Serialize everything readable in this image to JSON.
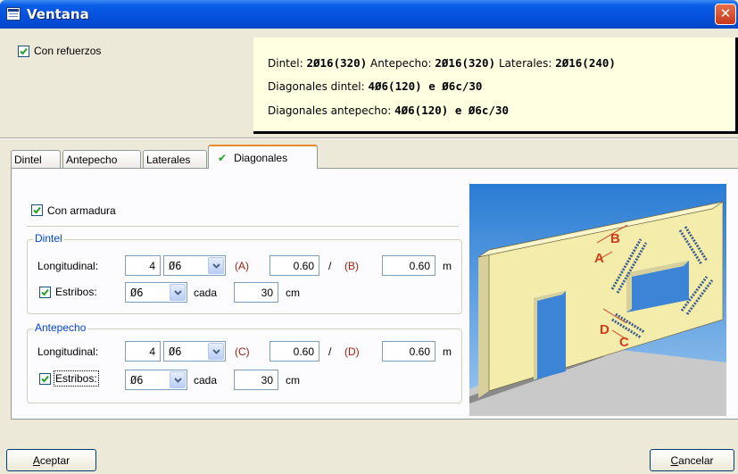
{
  "window": {
    "title": "Ventana",
    "close_glyph": "✕"
  },
  "refuerzos": {
    "label": "Con refuerzos",
    "checked": true
  },
  "summary": {
    "dintel_label": "Dintel:",
    "dintel_value": "2Ø16(320)",
    "antepecho_label": "Antepecho:",
    "antepecho_value": "2Ø16(320)",
    "laterales_label": "Laterales:",
    "laterales_value": "2Ø16(240)",
    "diag_dintel_label": "Diagonales dintel:",
    "diag_dintel_value": "4Ø6(120) e Ø6c/30",
    "diag_antepecho_label": "Diagonales antepecho:",
    "diag_antepecho_value": "4Ø6(120) e Ø6c/30"
  },
  "tabs": [
    {
      "label": "Dintel"
    },
    {
      "label": "Antepecho"
    },
    {
      "label": "Laterales"
    },
    {
      "label": "Diagonales",
      "check": "✔",
      "active": true
    }
  ],
  "panel": {
    "con_armadura": {
      "label": "Con armadura",
      "checked": true
    },
    "dintel": {
      "title": "Dintel",
      "longitudinal_label": "Longitudinal:",
      "count": "4",
      "diameter": "Ø6",
      "ref_a": "(A)",
      "value_a": "0.60",
      "slash": "/",
      "ref_b": "(B)",
      "value_b": "0.60",
      "unit_m": "m",
      "estribos_label": "Estribos:",
      "estribos_checked": true,
      "estribos_diameter": "Ø6",
      "cada_label": "cada",
      "spacing": "30",
      "unit_cm": "cm"
    },
    "antepecho": {
      "title": "Antepecho",
      "longitudinal_label": "Longitudinal:",
      "count": "4",
      "diameter": "Ø6",
      "ref_c": "(C)",
      "value_c": "0.60",
      "slash": "/",
      "ref_d": "(D)",
      "value_d": "0.60",
      "unit_m": "m",
      "estribos_label": "Estribos:",
      "estribos_checked": true,
      "estribos_diameter": "Ø6",
      "cada_label": "cada",
      "spacing": "30",
      "unit_cm": "cm"
    }
  },
  "illustration": {
    "label_a": "A",
    "label_b": "B",
    "label_c": "C",
    "label_d": "D"
  },
  "buttons": {
    "accept_mnemonic": "A",
    "accept_rest": "ceptar",
    "cancel_mnemonic": "C",
    "cancel_rest": "ancelar"
  }
}
